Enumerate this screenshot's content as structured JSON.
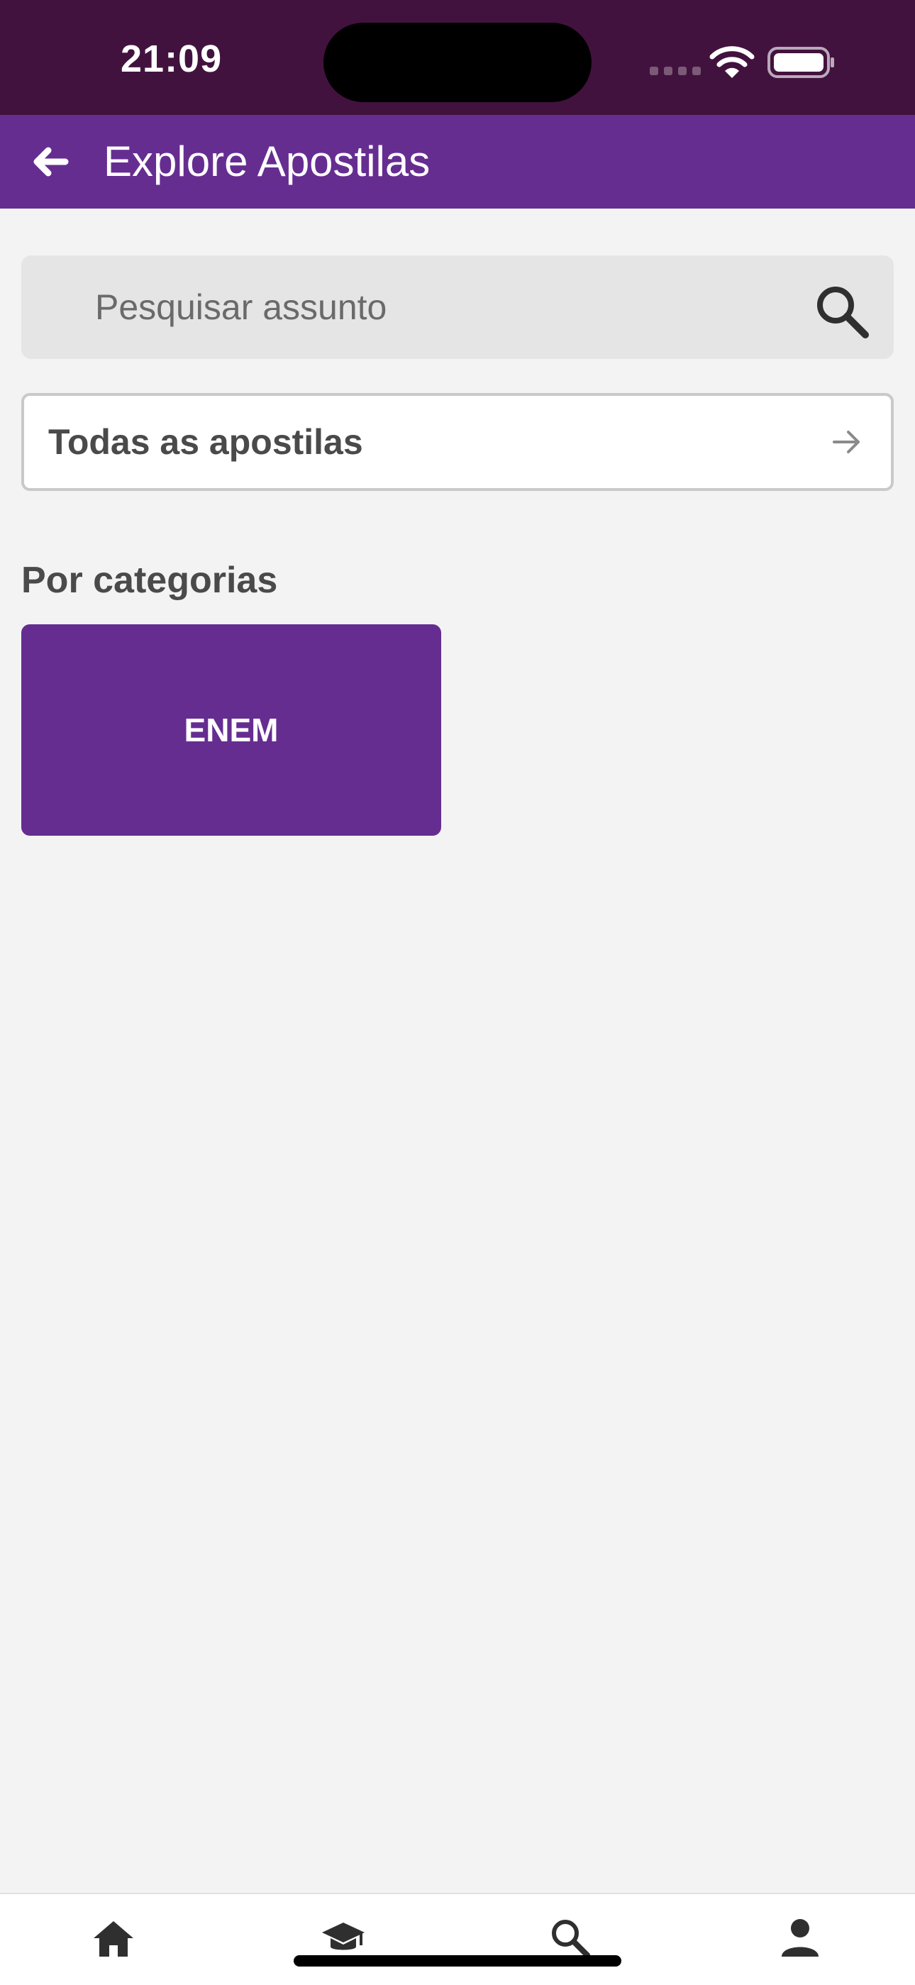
{
  "status_bar": {
    "time": "21:09"
  },
  "header": {
    "title": "Explore Apostilas",
    "back_icon": "arrow-left-icon",
    "background": "#662d91"
  },
  "search": {
    "placeholder": "Pesquisar assunto",
    "value": "",
    "icon": "search-icon"
  },
  "all_handouts": {
    "label": "Todas as apostilas",
    "icon": "arrow-right-icon"
  },
  "categories": {
    "title": "Por categorias",
    "items": [
      {
        "label": "ENEM",
        "color": "#662d91"
      }
    ]
  },
  "bottom_nav": {
    "items": [
      {
        "icon": "home-icon"
      },
      {
        "icon": "graduation-cap-icon"
      },
      {
        "icon": "search-icon"
      },
      {
        "icon": "person-icon"
      }
    ]
  },
  "colors": {
    "status_bar": "#42123e",
    "accent": "#662d91",
    "background": "#f3f3f3"
  }
}
